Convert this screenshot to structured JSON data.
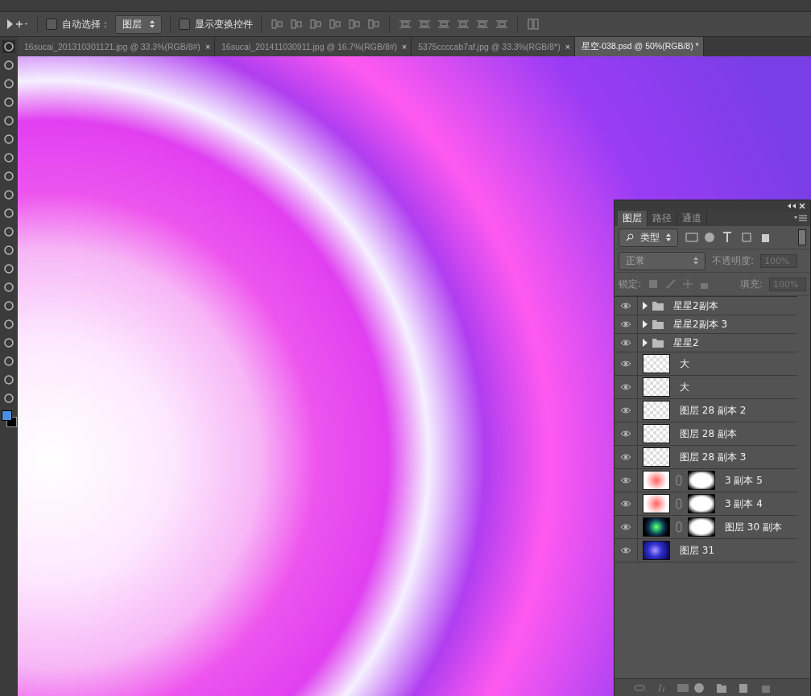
{
  "options_bar": {
    "auto_select": {
      "label": "自动选择：",
      "checked": false
    },
    "auto_select_target": "图层",
    "show_transform": {
      "label": "显示变换控件",
      "checked": false
    }
  },
  "document_tabs": [
    {
      "label": "16sucai_201310301121.jpg @ 33.3%(RGB/8#)",
      "close": "×",
      "selected": false
    },
    {
      "label": "16sucai_201411030911.jpg @ 16.7%(RGB/8#)",
      "close": "×",
      "selected": false
    },
    {
      "label": "5375ccccab7af.jpg @ 33.3%(RGB/8*)",
      "close": "×",
      "selected": false
    },
    {
      "label": "星空-038.psd @ 50%(RGB/8) *",
      "selected": true
    }
  ],
  "layers_panel": {
    "tabs": [
      {
        "label": "图层",
        "selected": true
      },
      {
        "label": "路径",
        "selected": false
      },
      {
        "label": "通道",
        "selected": false
      }
    ],
    "filter": "类型",
    "blend_mode": "正常",
    "opacity_label": "不透明度:",
    "opacity": "100%",
    "lock_label": "锁定:",
    "fill_label": "填充:",
    "fill": "100%",
    "layers": [
      {
        "name": "星星2副本",
        "kind": "group",
        "visible": true
      },
      {
        "name": "星星2副本 3",
        "kind": "group",
        "visible": true
      },
      {
        "name": "星星2",
        "kind": "group",
        "visible": true
      },
      {
        "name": "大",
        "kind": "transparent",
        "masked": false,
        "visible": true
      },
      {
        "name": "大",
        "kind": "transparent",
        "masked": false,
        "visible": true
      },
      {
        "name": "图层 28 副本 2",
        "kind": "transparent",
        "masked": false,
        "visible": true
      },
      {
        "name": "图层 28 副本",
        "kind": "transparent",
        "masked": false,
        "visible": true
      },
      {
        "name": "图层 28 副本 3",
        "kind": "transparent",
        "masked": false,
        "visible": true
      },
      {
        "name": "3 副本 5",
        "kind": "glow",
        "masked": true,
        "visible": true
      },
      {
        "name": "3 副本 4",
        "kind": "glow",
        "masked": true,
        "visible": true
      },
      {
        "name": "图层 30 副本",
        "kind": "swirl",
        "masked": true,
        "visible": true
      },
      {
        "name": "图层 31",
        "kind": "galaxy",
        "masked": false,
        "visible": true
      }
    ]
  }
}
